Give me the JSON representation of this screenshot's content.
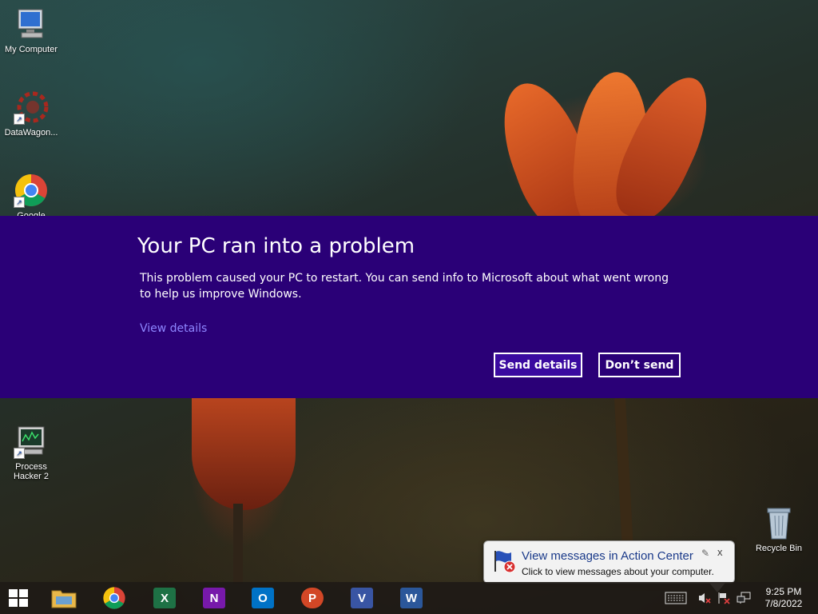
{
  "desktop": {
    "icons": [
      {
        "label": "My Computer"
      },
      {
        "label": "DataWagon..."
      },
      {
        "label": "Google Chrome"
      },
      {
        "label_line1": "Process",
        "label_line2": "Hacker 2"
      },
      {
        "label": "Recycle Bin"
      }
    ]
  },
  "dialog": {
    "title": "Your PC ran into a problem",
    "body": "This problem caused your PC to restart. You can send info to Microsoft about what went wrong to help us improve Windows.",
    "link": "View details",
    "send_button": "Send details",
    "dont_send_button": "Don’t send",
    "background_color": "#2a0077"
  },
  "notification": {
    "title": "View messages in Action Center",
    "text": "Click to view messages about your computer.",
    "close": "x"
  },
  "taskbar": {
    "apps": [
      {
        "name": "file-explorer-icon"
      },
      {
        "name": "chrome-icon"
      },
      {
        "name": "excel-icon",
        "letter": "X",
        "color": "#1e7145"
      },
      {
        "name": "onenote-icon",
        "letter": "N",
        "color": "#7719aa"
      },
      {
        "name": "outlook-icon",
        "letter": "O",
        "color": "#0072c6"
      },
      {
        "name": "powerpoint-icon",
        "letter": "P",
        "color": "#d24726"
      },
      {
        "name": "visio-icon",
        "letter": "V",
        "color": "#3955a3"
      },
      {
        "name": "word-icon",
        "letter": "W",
        "color": "#2b579a"
      }
    ],
    "clock": {
      "time": "9:25 PM",
      "date": "7/8/2022"
    }
  }
}
